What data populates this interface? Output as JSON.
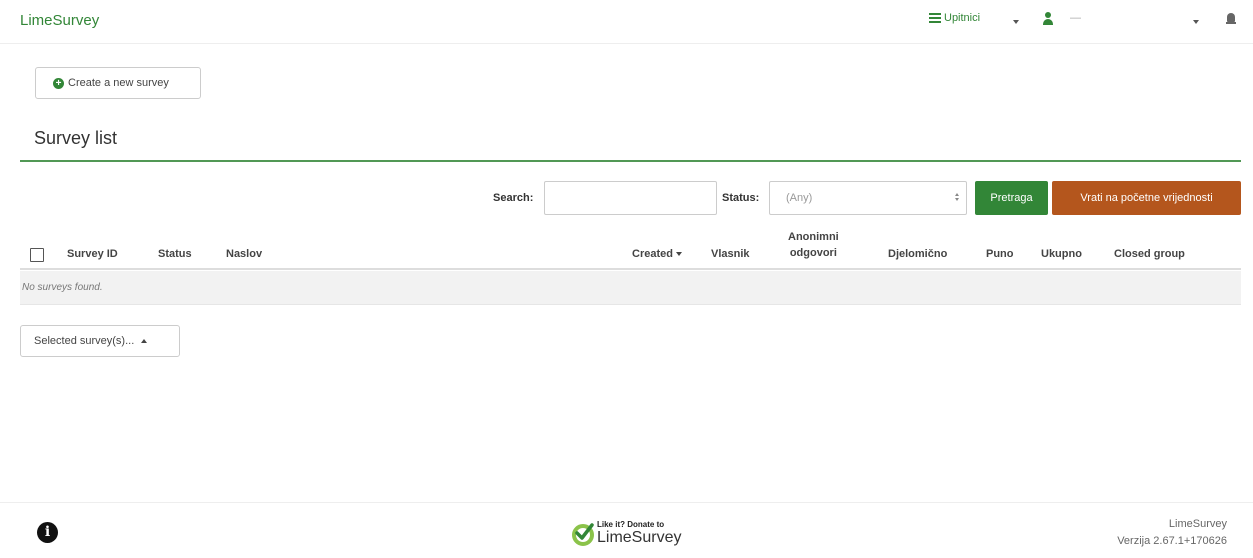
{
  "navbar": {
    "brand": "LimeSurvey",
    "surveys_label": "Upitnici",
    "user_label": "—"
  },
  "create_button_label": "Create a new survey",
  "page_title": "Survey list",
  "filters": {
    "search_label": "Search:",
    "search_value": "",
    "status_label": "Status:",
    "status_selected": "(Any)",
    "search_button": "Pretraga",
    "reset_button": "Vrati na početne vrijednosti"
  },
  "table": {
    "columns": {
      "survey_id": "Survey ID",
      "status": "Status",
      "title": "Naslov",
      "created": "Created",
      "owner": "Vlasnik",
      "anonymous_line1": "Anonimni",
      "anonymous_line2": "odgovori",
      "partial": "Djelomično",
      "full": "Puno",
      "total": "Ukupno",
      "closed_group": "Closed group"
    },
    "empty_message": "No surveys found."
  },
  "mass_action_label": "Selected survey(s)...",
  "footer": {
    "donate_small": "Like it? Donate to",
    "donate_big": "LimeSurvey",
    "app_name": "LimeSurvey",
    "version": "Verzija 2.67.1+170626"
  },
  "colors": {
    "brand_green": "#328637",
    "reset_orange": "#b4561d"
  },
  "icons": [
    "list-icon",
    "user-icon",
    "bell-icon",
    "plus-circle-icon",
    "info-icon",
    "limesurvey-leaf-icon"
  ]
}
